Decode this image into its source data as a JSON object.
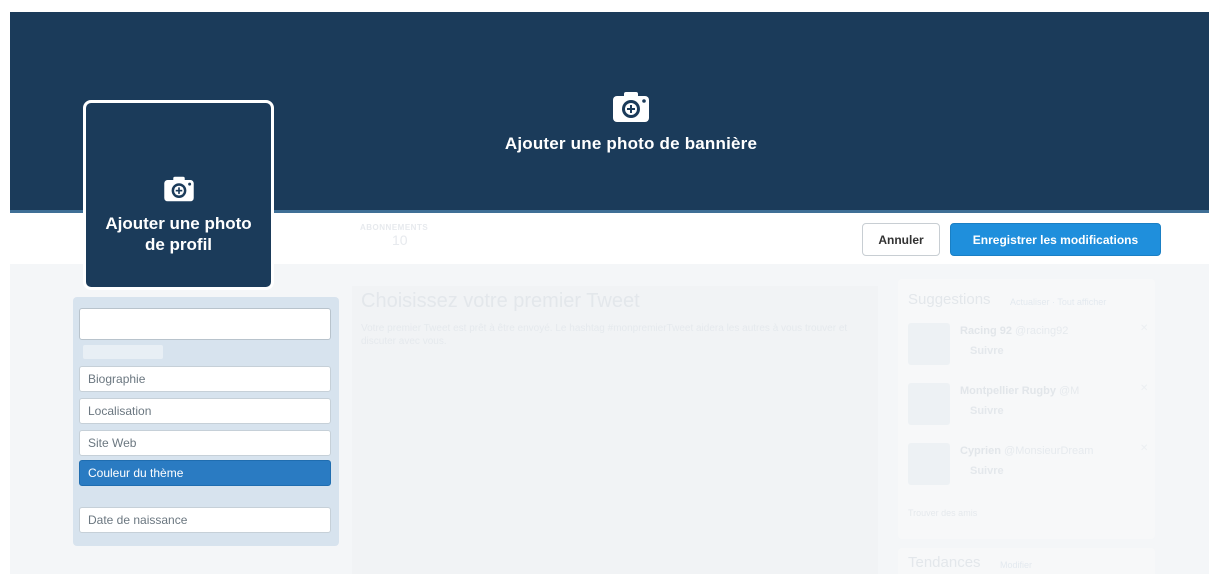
{
  "banner": {
    "cta_label": "Ajouter une photo de bannière",
    "icon": "camera-icon"
  },
  "profile": {
    "cta_label": "Ajouter une photo de profil",
    "icon": "camera-icon"
  },
  "stats": {
    "label": "ABONNEMENTS",
    "value": "10"
  },
  "actions": {
    "cancel_label": "Annuler",
    "save_label": "Enregistrer les modifications"
  },
  "form": {
    "name_value": "",
    "bio_placeholder": "Biographie",
    "location_placeholder": "Localisation",
    "website_placeholder": "Site Web",
    "theme_label": "Couleur du thème",
    "birthdate_placeholder": "Date de naissance"
  },
  "main": {
    "title": "Choisissez votre premier Tweet",
    "description": "Votre premier Tweet est prêt à être envoyé. Le hashtag #monpremierTweet aidera les autres à vous trouver et discuter avec vous."
  },
  "suggestions": {
    "title": "Suggestions",
    "refresh": "Actualiser",
    "view_all": "Tout afficher",
    "items": [
      {
        "name": "Racing 92",
        "handle": "@racing92",
        "follow": "Suivre"
      },
      {
        "name": "Montpellier Rugby",
        "handle": "@M",
        "follow": "Suivre"
      },
      {
        "name": "Cyprien",
        "handle": "@MonsieurDream",
        "follow": "Suivre"
      }
    ],
    "find_friends": "Trouver des amis"
  },
  "trends": {
    "title": "Tendances",
    "change": "Modifier"
  },
  "colors": {
    "banner": "#1b3b5a",
    "accent": "#1f8fdc",
    "theme_selected": "#2a7bc2"
  }
}
